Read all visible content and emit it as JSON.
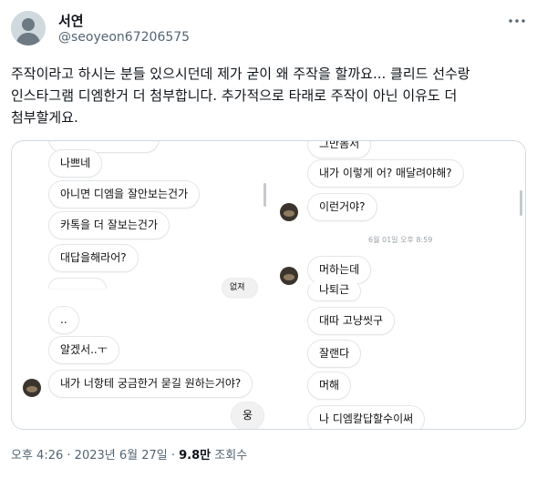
{
  "author": {
    "name": "서연",
    "handle": "@seoyeon67206575",
    "avatar_icon": "default-avatar-icon"
  },
  "more_icon": "more-horizontal-icon",
  "tweet": {
    "lines": [
      "주작이라고 하시는 분들 있으시던데 제가 굳이 왜 주작을 할까요... 클리드 선수랑",
      "인스타그램 디엠한거 더 첨부합니다. 추가적으로 타래로 주작이 아닌 이유도 더",
      "첨부할게요."
    ]
  },
  "screenshot_left": {
    "messages": [
      "나쁘네",
      "아니면 디엠을 잘안보는건가",
      "카톡을 더 잘보는건가",
      "대답을해라어?",
      "..",
      "알겠서..ㅜ",
      "내가 너항테 궁금한거 묻길 원하는거야?",
      "웅"
    ],
    "partial_label": "없져"
  },
  "screenshot_right": {
    "messages": [
      "그만봄서",
      "내가 이렇게 어? 매달려야해?",
      "이런거야?",
      "머하는데",
      "나퇴근",
      "대따 고냥씻구",
      "잘랜다",
      "머해",
      "나 디엠칼답할수이써"
    ],
    "timestamp": "6월 01일 오후 8:59"
  },
  "meta": {
    "time": "오후 4:26",
    "separator": "·",
    "date": "2023년 6월 27일",
    "views_count": "9.8만",
    "views_label": "조회수"
  },
  "colors": {
    "text": "#0f1419",
    "secondary": "#536471",
    "border": "#cfd9de"
  }
}
